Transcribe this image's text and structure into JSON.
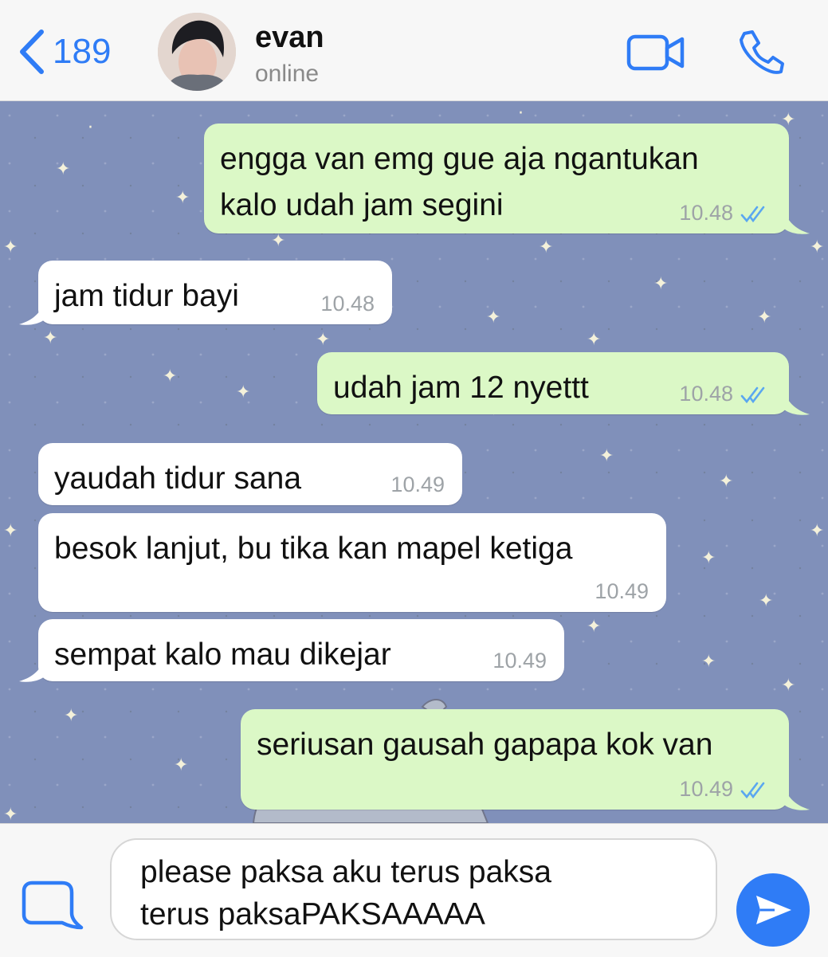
{
  "header": {
    "back_count": "189",
    "contact_name": "evan",
    "contact_status": "online"
  },
  "messages": [
    {
      "direction": "out",
      "lines": [
        "engga van emg gue aja ngantukan",
        "kalo udah jam segini"
      ],
      "time": "10.48",
      "read": true
    },
    {
      "direction": "in",
      "lines": [
        "jam tidur bayi"
      ],
      "time": "10.48"
    },
    {
      "direction": "out",
      "lines": [
        "udah jam 12 nyettt"
      ],
      "time": "10.48",
      "read": true
    },
    {
      "direction": "in",
      "lines": [
        "yaudah tidur sana"
      ],
      "time": "10.49"
    },
    {
      "direction": "in",
      "lines": [
        "besok lanjut, bu tika kan mapel ketiga"
      ],
      "time": "10.49"
    },
    {
      "direction": "in",
      "lines": [
        "sempat kalo mau dikejar"
      ],
      "time": "10.49"
    },
    {
      "direction": "out",
      "lines": [
        "seriusan gausah gapapa kok van"
      ],
      "time": "10.49",
      "read": true
    }
  ],
  "composer": {
    "lines": [
      "please paksa aku terus paksa",
      "terus paksaPAKSAAAAA"
    ]
  },
  "icons": {
    "back": "chevron-left-icon",
    "video_call": "video-camera-icon",
    "voice_call": "phone-icon",
    "attach": "attachment-icon",
    "send": "send-icon",
    "read_receipt": "double-check-icon"
  },
  "colors": {
    "accent": "#2f7cf6",
    "outgoing_bubble": "#dbf8c6",
    "incoming_bubble": "#ffffff",
    "chat_wallpaper": "#8090ba",
    "read_tick": "#5aa7f0"
  }
}
